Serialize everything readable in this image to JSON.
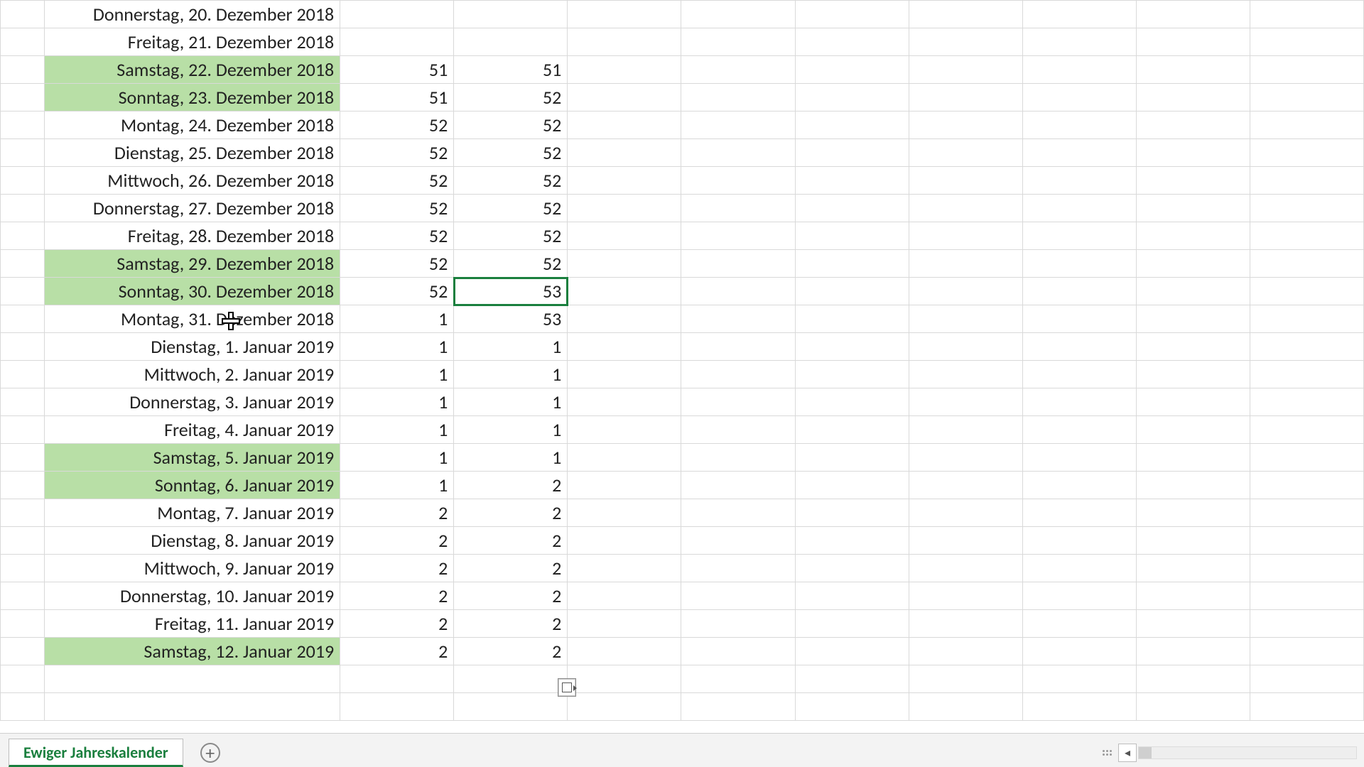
{
  "sheet": {
    "tab_name": "Ewiger Jahreskalender",
    "selected_cell": {
      "row_index": 10,
      "col": "c2"
    },
    "cursor_row_index": 11,
    "rows": [
      {
        "date": "Donnerstag, 20. Dezember 2018",
        "c1": "",
        "c2": "",
        "weekend": false
      },
      {
        "date": "Freitag, 21. Dezember 2018",
        "c1": "",
        "c2": "",
        "weekend": false
      },
      {
        "date": "Samstag, 22. Dezember 2018",
        "c1": "51",
        "c2": "51",
        "weekend": true
      },
      {
        "date": "Sonntag, 23. Dezember 2018",
        "c1": "51",
        "c2": "52",
        "weekend": true
      },
      {
        "date": "Montag, 24. Dezember 2018",
        "c1": "52",
        "c2": "52",
        "weekend": false
      },
      {
        "date": "Dienstag, 25. Dezember 2018",
        "c1": "52",
        "c2": "52",
        "weekend": false
      },
      {
        "date": "Mittwoch, 26. Dezember 2018",
        "c1": "52",
        "c2": "52",
        "weekend": false
      },
      {
        "date": "Donnerstag, 27. Dezember 2018",
        "c1": "52",
        "c2": "52",
        "weekend": false
      },
      {
        "date": "Freitag, 28. Dezember 2018",
        "c1": "52",
        "c2": "52",
        "weekend": false
      },
      {
        "date": "Samstag, 29. Dezember 2018",
        "c1": "52",
        "c2": "52",
        "weekend": true
      },
      {
        "date": "Sonntag, 30. Dezember 2018",
        "c1": "52",
        "c2": "53",
        "weekend": true
      },
      {
        "date": "Montag, 31. Dezember 2018",
        "c1": "1",
        "c2": "53",
        "weekend": false
      },
      {
        "date": "Dienstag, 1. Januar 2019",
        "c1": "1",
        "c2": "1",
        "weekend": false
      },
      {
        "date": "Mittwoch, 2. Januar 2019",
        "c1": "1",
        "c2": "1",
        "weekend": false
      },
      {
        "date": "Donnerstag, 3. Januar 2019",
        "c1": "1",
        "c2": "1",
        "weekend": false
      },
      {
        "date": "Freitag, 4. Januar 2019",
        "c1": "1",
        "c2": "1",
        "weekend": false
      },
      {
        "date": "Samstag, 5. Januar 2019",
        "c1": "1",
        "c2": "1",
        "weekend": true
      },
      {
        "date": "Sonntag, 6. Januar 2019",
        "c1": "1",
        "c2": "2",
        "weekend": true
      },
      {
        "date": "Montag, 7. Januar 2019",
        "c1": "2",
        "c2": "2",
        "weekend": false
      },
      {
        "date": "Dienstag, 8. Januar 2019",
        "c1": "2",
        "c2": "2",
        "weekend": false
      },
      {
        "date": "Mittwoch, 9. Januar 2019",
        "c1": "2",
        "c2": "2",
        "weekend": false
      },
      {
        "date": "Donnerstag, 10. Januar 2019",
        "c1": "2",
        "c2": "2",
        "weekend": false
      },
      {
        "date": "Freitag, 11. Januar 2019",
        "c1": "2",
        "c2": "2",
        "weekend": false
      },
      {
        "date": "Samstag, 12. Januar 2019",
        "c1": "2",
        "c2": "2",
        "weekend": true
      }
    ],
    "blank_trailing_rows": 2,
    "extra_blank_cols": 7
  },
  "icons": {
    "add_tab": "+",
    "scroll_left": "◂",
    "scroll_right": "▸"
  }
}
